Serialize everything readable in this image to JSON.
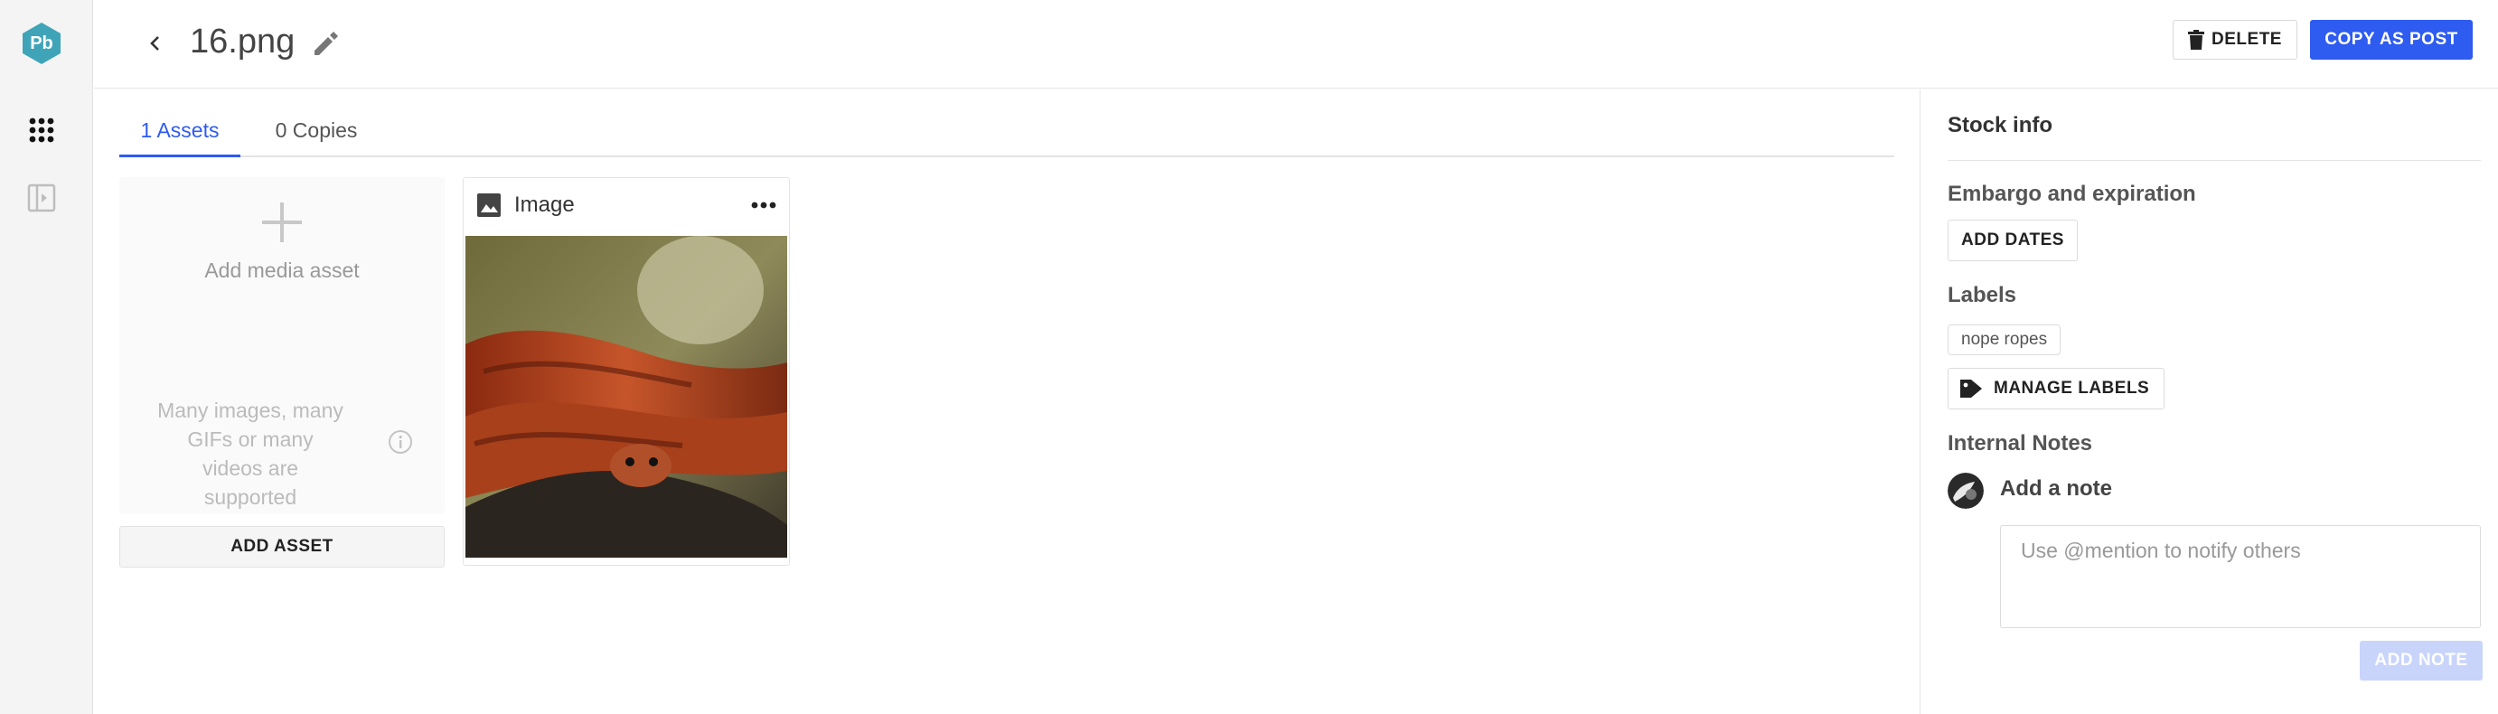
{
  "rail": {
    "logo_text": "Pb",
    "logo_color": "#3fa4b8"
  },
  "header": {
    "title": "16.png",
    "delete_label": "DELETE",
    "copy_label": "COPY AS POST"
  },
  "tabs": [
    {
      "label": "1 Assets",
      "active": true
    },
    {
      "label": "0 Copies",
      "active": false
    }
  ],
  "add_media": {
    "label": "Add media asset",
    "support_text": "Many images, many GIFs or many videos are supported",
    "button_label": "ADD ASSET"
  },
  "asset": {
    "type_label": "Image"
  },
  "side_panel": {
    "title": "Stock info",
    "embargo_heading": "Embargo and expiration",
    "add_dates_label": "ADD DATES",
    "labels_heading": "Labels",
    "labels": [
      "nope ropes"
    ],
    "manage_labels_label": "MANAGE LABELS",
    "notes_heading": "Internal Notes",
    "add_note_heading": "Add a note",
    "note_placeholder": "Use @mention to notify others",
    "add_note_button": "ADD NOTE"
  },
  "colors": {
    "accent": "#2e5bf0",
    "accent_disabled": "#c9d4fb"
  },
  "icons": [
    "pb-logo-icon",
    "apps-grid-icon",
    "sidebar-toggle-icon",
    "chevron-left-icon",
    "pencil-icon",
    "trash-icon",
    "plus-icon",
    "info-icon",
    "image-icon",
    "more-horizontal-icon",
    "tag-icon"
  ]
}
